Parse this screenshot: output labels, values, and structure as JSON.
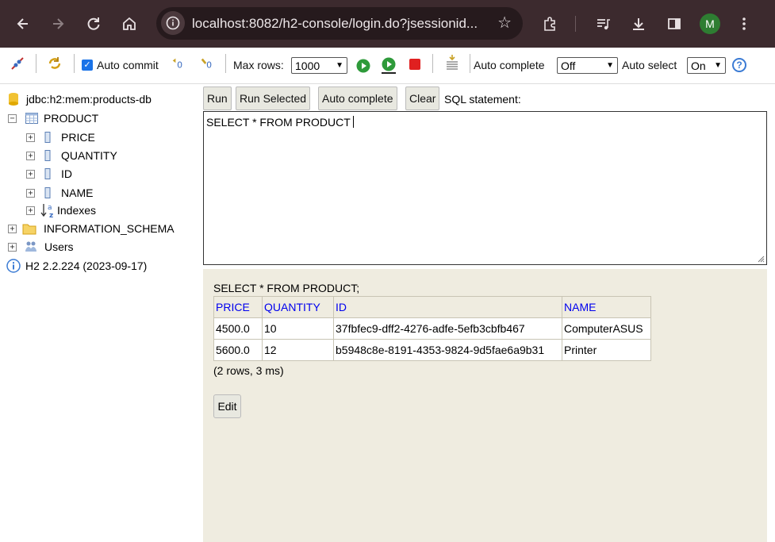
{
  "browser": {
    "url": "localhost:8082/h2-console/login.do?jsessionid...",
    "profile_initial": "M"
  },
  "toolbar": {
    "auto_commit_label": "Auto commit",
    "auto_commit_checked": true,
    "max_rows_label": "Max rows:",
    "max_rows_value": "1000",
    "auto_complete_label": "Auto complete",
    "auto_complete_value": "Off",
    "auto_select_label": "Auto select",
    "auto_select_value": "On",
    "help_symbol": "?"
  },
  "tree": {
    "connection": "jdbc:h2:mem:products-db",
    "table": "PRODUCT",
    "columns": [
      "PRICE",
      "QUANTITY",
      "ID",
      "NAME"
    ],
    "indexes": "Indexes",
    "schema": "INFORMATION_SCHEMA",
    "users": "Users",
    "version": "H2 2.2.224 (2023-09-17)"
  },
  "actions": {
    "run": "Run",
    "run_selected": "Run Selected",
    "auto_complete": "Auto complete",
    "clear": "Clear",
    "sql_label": "SQL statement:"
  },
  "editor": {
    "sql": "SELECT * FROM PRODUCT "
  },
  "results": {
    "query": "SELECT * FROM PRODUCT;",
    "headers": [
      "PRICE",
      "QUANTITY",
      "ID",
      "NAME"
    ],
    "rows": [
      [
        "4500.0",
        "10",
        "37fbfec9-dff2-4276-adfe-5efb3cbfb467",
        "ComputerASUS"
      ],
      [
        "5600.0",
        "12",
        "b5948c8e-8191-4353-9824-9d5fae6a9b31",
        "Printer"
      ]
    ],
    "summary": "(2 rows, 3 ms)",
    "edit_label": "Edit"
  }
}
